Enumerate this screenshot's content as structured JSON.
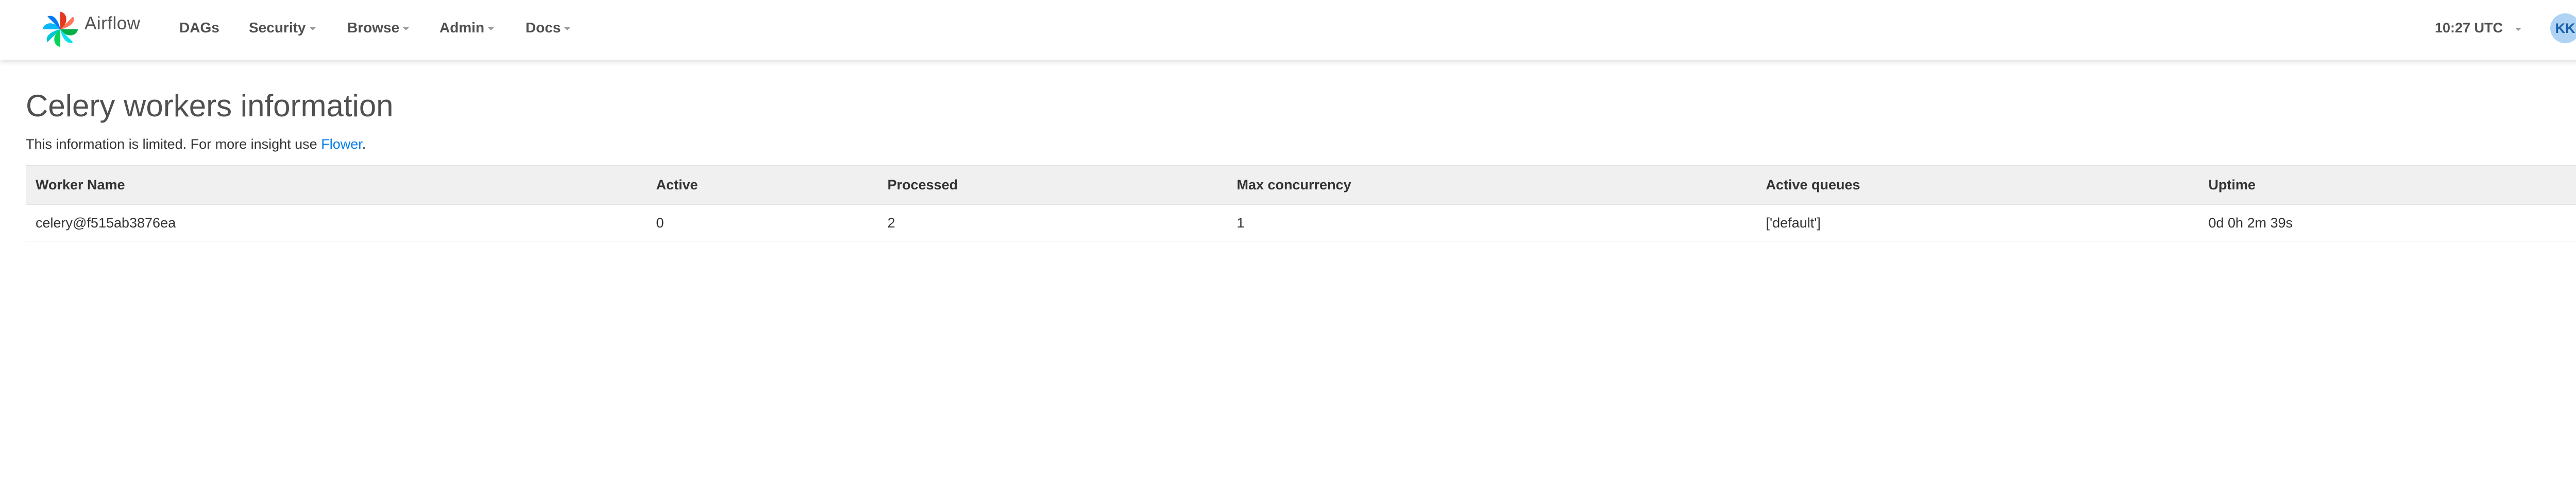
{
  "navbar": {
    "brand": "Airflow",
    "items": [
      {
        "label": "DAGs",
        "dropdown": false
      },
      {
        "label": "Security",
        "dropdown": true
      },
      {
        "label": "Browse",
        "dropdown": true
      },
      {
        "label": "Admin",
        "dropdown": true
      },
      {
        "label": "Docs",
        "dropdown": true
      }
    ],
    "time": "10:27 UTC",
    "user_initials": "KK"
  },
  "page": {
    "title": "Celery workers information",
    "info_prefix": "This information is limited. For more insight use ",
    "info_link": "Flower",
    "info_suffix": "."
  },
  "table": {
    "columns": [
      "Worker Name",
      "Active",
      "Processed",
      "Max concurrency",
      "Active queues",
      "Uptime"
    ],
    "rows": [
      [
        "celery@f515ab3876ea",
        "0",
        "2",
        "1",
        "['default']",
        "0d 0h 2m 39s"
      ]
    ]
  },
  "colors": {
    "link": "#017cee",
    "avatar_bg": "#aed3f5",
    "header_bg": "#f0f0f0"
  },
  "icons": {
    "logo": "airflow-pinwheel-icon",
    "dropdown": "chevron-down-icon"
  }
}
